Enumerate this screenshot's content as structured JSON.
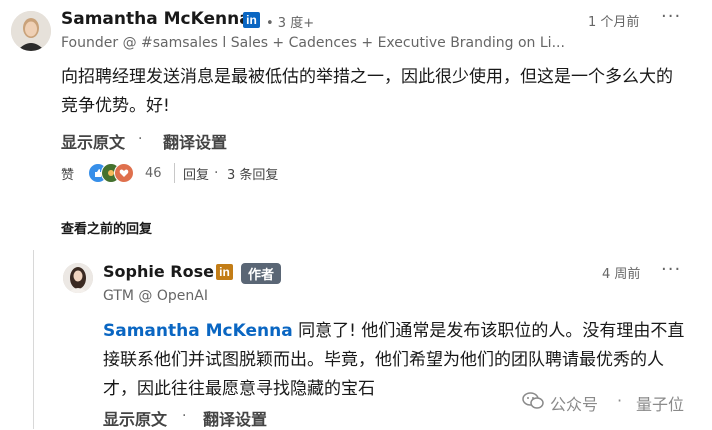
{
  "comment": {
    "author": "Samantha McKenna",
    "degree": "• 3 度+",
    "headline": "Founder @ #samsales l Sales + Cadences + Executive Branding on Li...",
    "time": "1 个月前",
    "more": "···",
    "text": "向招聘经理发送消息是最被低估的举措之一，因此很少使用，但这是一个多么大的竞争优势。好!",
    "show_original": "显示原文",
    "translate_settings": "翻译设置",
    "like": "赞",
    "reaction_count": "46",
    "reply": "回复",
    "reply_count": "3 条回复",
    "view_earlier": "查看之前的回复"
  },
  "reply": {
    "author": "Sophie Rose",
    "author_tag": "作者",
    "headline": "GTM @ OpenAI",
    "time": "4 周前",
    "more": "···",
    "mention": "Samantha McKenna",
    "text": " 同意了! 他们通常是发布该职位的人。没有理由不直接联系他们并试图脱颖而出。毕竟，他们希望为他们的团队聘请最优秀的人才，因此往往最愿意寻找隐藏的宝石",
    "show_original": "显示原文",
    "translate_settings": "翻译设置"
  },
  "separator": "·",
  "linkedin_badge": "in",
  "watermark": {
    "source": "公众号",
    "dot": "·",
    "brand": "量子位"
  },
  "colors": {
    "linkedin_blue": "#0a66c2",
    "author_tag_bg": "#5a6675",
    "mention": "#0a66c2"
  },
  "icons": [
    "avatar",
    "linkedin-badge",
    "more-icon",
    "like-reaction-icon",
    "celebrate-reaction-icon",
    "love-reaction-icon",
    "wechat-icon"
  ]
}
